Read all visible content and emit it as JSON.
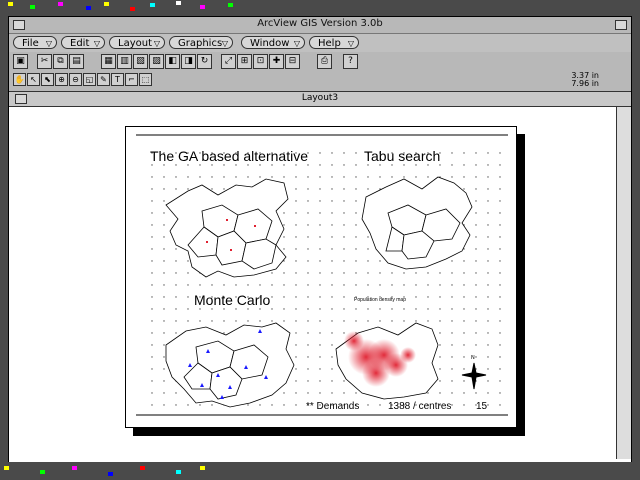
{
  "app": {
    "title": "ArcView GIS Version 3.0b"
  },
  "menus": [
    {
      "label": "File"
    },
    {
      "label": "Edit"
    },
    {
      "label": "Layout"
    },
    {
      "label": "Graphics"
    },
    {
      "label": "Window"
    },
    {
      "label": "Help"
    }
  ],
  "coords": {
    "x": "3.37 in",
    "y": "7.96 in"
  },
  "layout_window": {
    "title": "Layout3"
  },
  "page": {
    "panel_ga": "The GA based alternative",
    "panel_tabu": "Tabu search",
    "panel_mc": "Monte Carlo",
    "panel_pop": "Population density map",
    "footer_demands": "** Demands",
    "footer_count": "1388 / centres",
    "footer_num": "15"
  },
  "colors": {
    "desktop": "#4a4a4a",
    "chrome": "#b8b8b8",
    "accent_red": "#e02030",
    "marker_blue": "#1a1aff"
  },
  "icons": [
    "file-icon",
    "edit-icon",
    "layout-icon",
    "graphics-icon",
    "window-icon",
    "help-icon",
    "print-icon",
    "pointer-icon",
    "text-icon",
    "zoom-in-icon",
    "zoom-out-icon",
    "pan-icon"
  ]
}
